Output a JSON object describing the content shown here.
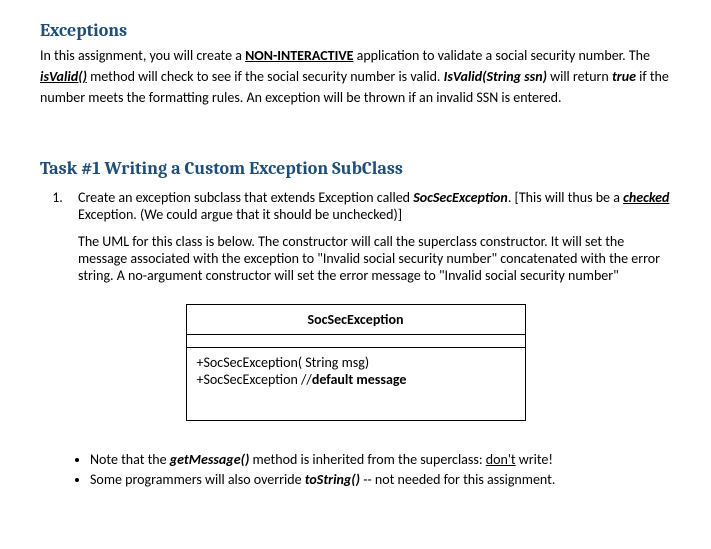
{
  "heading1": "Exceptions",
  "intro": {
    "p1a": " In this assignment, you will create a ",
    "noninteractive": "NON-INTERACTIVE",
    "p1b": " application to validate a social security number. The ",
    "isvalid1": "isValid()",
    "p1c": " method  will  check to see if the social security number is valid.  ",
    "isvalid2": "IsValid(String ssn)",
    "p1d": " will return ",
    "true": "true",
    "p1e": " if the number meets the formatting rules.   An exception will be thrown if an invalid SSN is entered."
  },
  "heading2": "Task #1 Writing a Custom Exception SubClass",
  "task1": {
    "li1a": "Create an exception subclass that extends Exception called ",
    "socsec": "SocSecException",
    "li1b": ". [This will thus be a ",
    "checked": "checked",
    "li1c": " Exception.  (We could argue that it should be unchecked)]",
    "para2": "The UML for this class is  below.  The constructor will call the superclass constructor. It will set the message associated with the exception to \"Invalid social security number\" concatenated with the error string.  A no-argument constructor will set the error message to \"Invalid social security number\""
  },
  "uml": {
    "title": "SocSecException",
    "method1": "+SocSecException( String msg)",
    "method2a": "+SocSecException   //",
    "method2b": "default message"
  },
  "notes": {
    "b1a": "Note that the ",
    "getmessage": "getMessage()",
    "b1b": " method is inherited from the superclass: ",
    "dont": "don't",
    "b1c": " write!",
    "b2a": "Some programmers will also override ",
    "tostring": "toString()",
    "b2b": "  --  not needed for this assignment."
  }
}
